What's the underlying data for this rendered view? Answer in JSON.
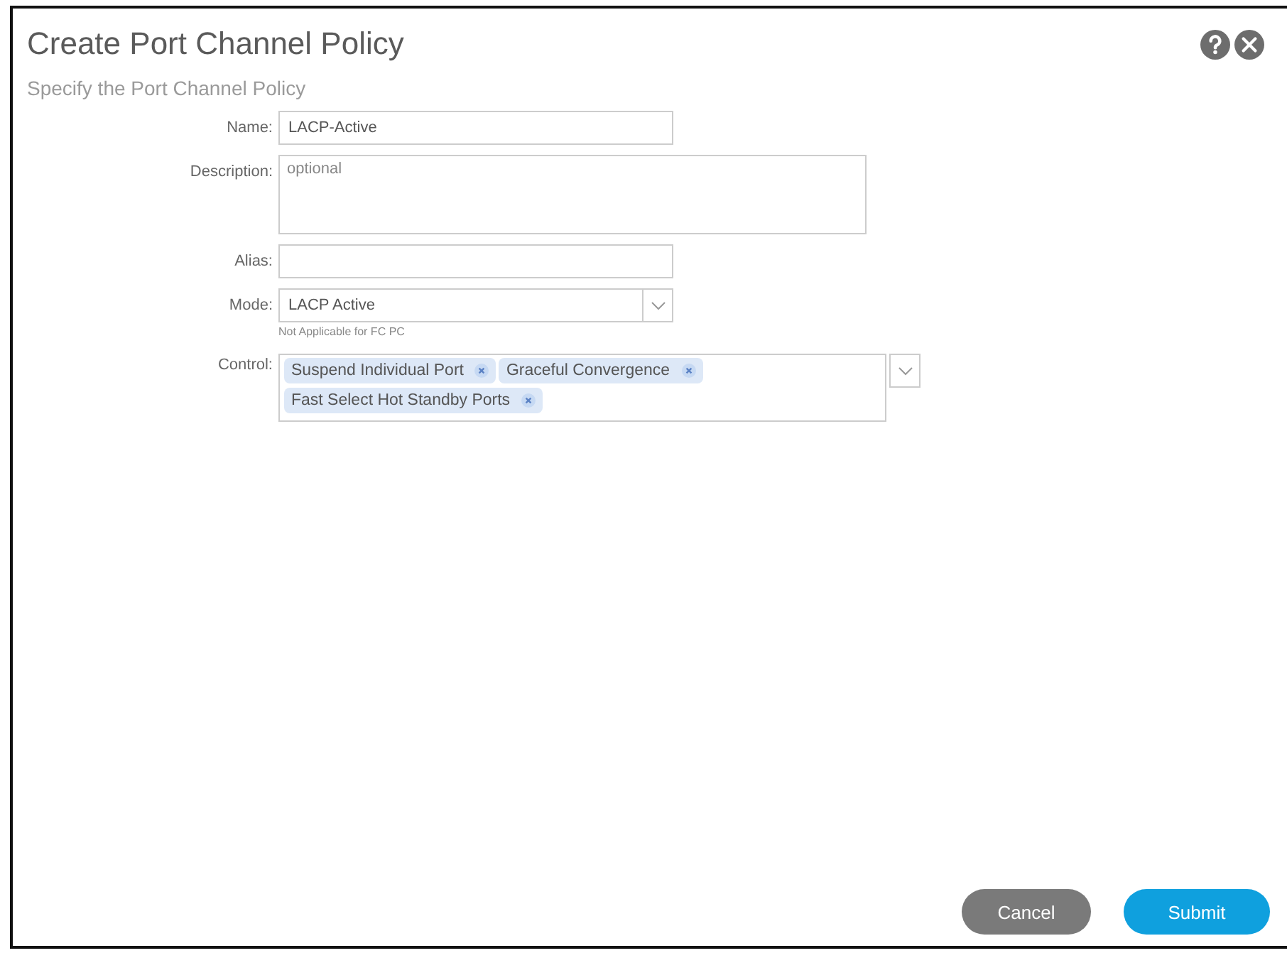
{
  "dialog": {
    "title": "Create Port Channel Policy",
    "subtitle": "Specify the Port Channel Policy"
  },
  "fields": [
    {
      "kind": "text",
      "label": "Name:",
      "value": "LACP-Active"
    },
    {
      "kind": "textarea",
      "label": "Description:",
      "placeholder": "optional"
    },
    {
      "kind": "text",
      "label": "Alias:"
    },
    {
      "kind": "select",
      "label": "Mode:",
      "value": "LACP Active",
      "hint": "Not Applicable for FC PC"
    },
    {
      "kind": "tags",
      "label": "Control:",
      "tags": [
        "Suspend Individual Port",
        "Graceful Convergence",
        "Fast Select Hot Standby Ports"
      ]
    }
  ],
  "buttons": [
    {
      "label": "Cancel",
      "kind": "secondary"
    },
    {
      "label": "Submit",
      "kind": "primary"
    }
  ]
}
